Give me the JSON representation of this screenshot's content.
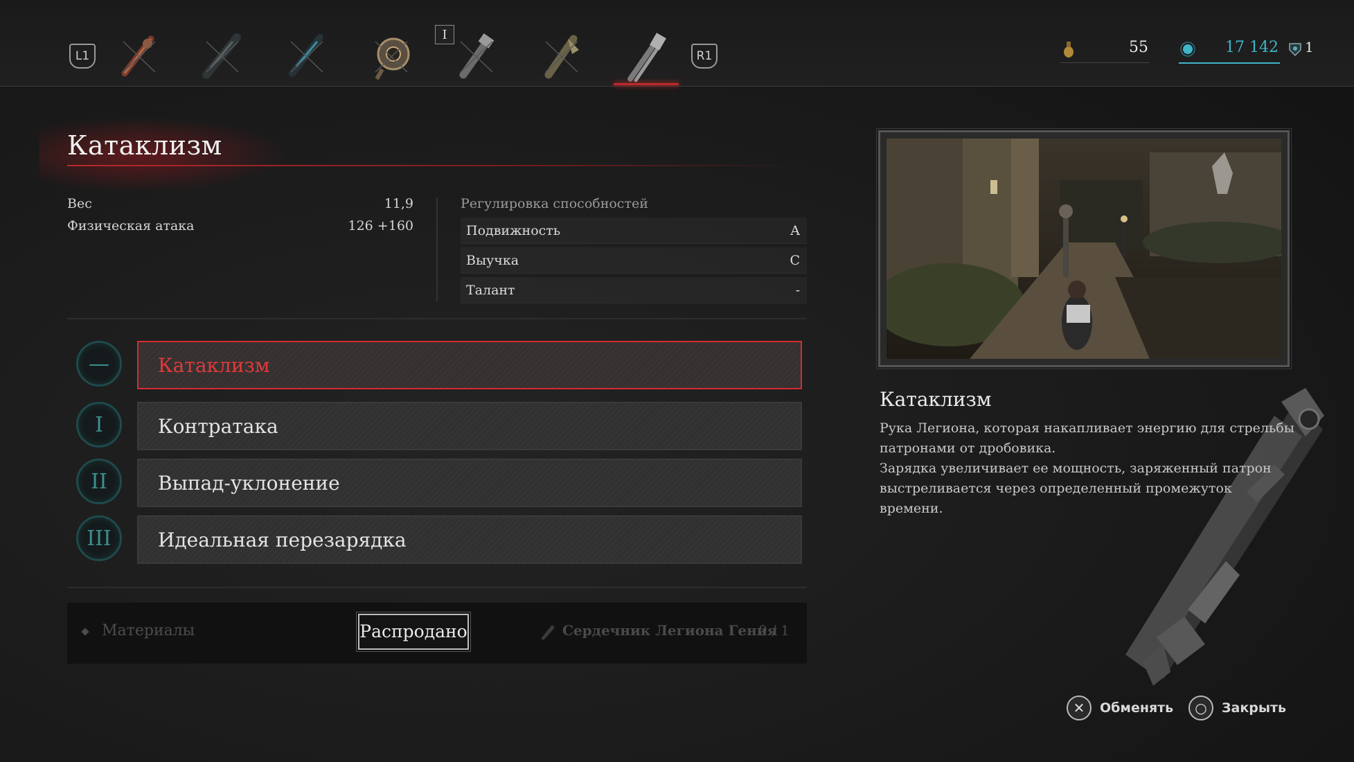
{
  "tabs": {
    "left_shoulder": "L1",
    "right_shoulder": "R1",
    "position_marker": "I",
    "items": [
      {
        "icon": "weapon-1-icon"
      },
      {
        "icon": "weapon-2-icon"
      },
      {
        "icon": "weapon-3-icon"
      },
      {
        "icon": "weapon-4-icon"
      },
      {
        "icon": "weapon-5-icon"
      },
      {
        "icon": "weapon-6-icon"
      },
      {
        "icon": "weapon-7-icon",
        "active": true
      }
    ]
  },
  "currency": {
    "ergo_vial": "55",
    "ergo": "17 142",
    "gems": "1"
  },
  "item": {
    "title": "Катаклизм",
    "stats": [
      {
        "label": "Вес",
        "value": "11,9"
      },
      {
        "label": "Физическая атака",
        "value": "126 +160"
      }
    ],
    "adjustment": {
      "title": "Регулировка способностей",
      "rows": [
        {
          "label": "Подвижность",
          "grade": "A"
        },
        {
          "label": "Выучка",
          "grade": "C"
        },
        {
          "label": "Талант",
          "grade": "-"
        }
      ]
    }
  },
  "skills": [
    {
      "badge": "—",
      "name": "Катаклизм",
      "active": true
    },
    {
      "badge": "I",
      "name": "Контратака"
    },
    {
      "badge": "II",
      "name": "Выпад-уклонение"
    },
    {
      "badge": "III",
      "name": "Идеальная перезарядка"
    }
  ],
  "materials": {
    "label": "Материалы",
    "sold_out": "Распродано",
    "requirement": "Сердечник Легиона Гения",
    "count": "0 / 1"
  },
  "description": {
    "title": "Катаклизм",
    "lines": [
      "Рука Легиона, которая накапливает энергию для стрельбы",
      "патронами от дробовика.",
      "Зарядка увеличивает ее мощность, заряженный патрон",
      "выстреливается через определенный промежуток времени."
    ]
  },
  "controls": {
    "exchange": "Обменять",
    "close": "Закрыть"
  },
  "colors": {
    "accent_red": "#d62b2f",
    "teal": "#3d8e90",
    "ergo_teal": "#3fb5c9"
  }
}
